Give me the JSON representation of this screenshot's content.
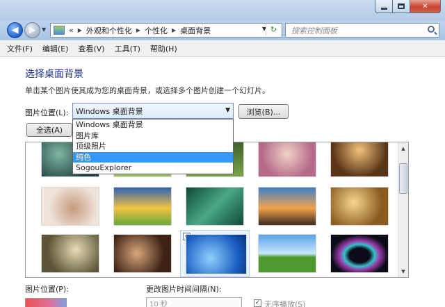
{
  "window": {
    "min_icon": "minimize-icon",
    "max_icon": "maximize-icon",
    "close_label": "✕"
  },
  "nav": {
    "back_icon": "back-arrow-icon",
    "forward_icon": "forward-arrow-icon",
    "breadcrumbs": [
      "«",
      "外观和个性化",
      "个性化",
      "桌面背景"
    ],
    "search_placeholder": "搜索控制面板"
  },
  "menu": [
    "文件(F)",
    "编辑(E)",
    "查看(V)",
    "工具(T)",
    "帮助(H)"
  ],
  "page": {
    "title": "选择桌面背景",
    "description": "单击某个图片使其成为您的桌面背景，或选择多个图片创建一个幻灯片。",
    "location_label": "图片位置(L):",
    "location_value": "Windows 桌面背景",
    "browse_label": "浏览(B)...",
    "select_all_label": "全选(A)",
    "location_options": [
      "Windows 桌面背景",
      "图片库",
      "顶级照片",
      "纯色",
      "SogouExplorer"
    ],
    "highlighted_option": "纯色",
    "position_label": "图片位置(P):",
    "interval_label": "更改图片时间间隔(N):",
    "interval_value": "10 秒",
    "shuffle_label": "无序播放(S)",
    "shuffle_checked": true
  },
  "gallery": {
    "selected_check": "✓",
    "rows": 3,
    "cols": 5
  }
}
